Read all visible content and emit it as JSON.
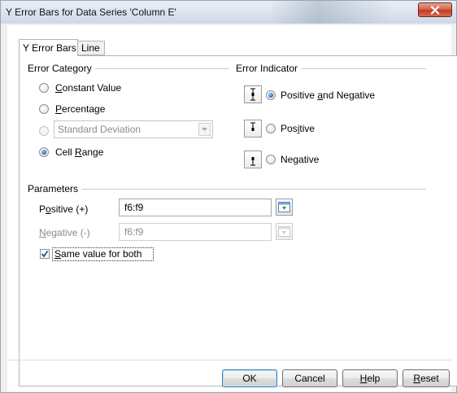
{
  "window": {
    "title": "Y Error Bars for Data Series 'Column E'",
    "close_icon": "close-icon"
  },
  "tabs": [
    {
      "label": "Y Error Bars",
      "active": true
    },
    {
      "label": "Line",
      "active": false
    }
  ],
  "error_category": {
    "label": "Error Category",
    "options": [
      {
        "pre": "",
        "key": "C",
        "post": "onstant Value",
        "checked": false,
        "enabled": true
      },
      {
        "pre": "",
        "key": "P",
        "post": "ercentage",
        "checked": false,
        "enabled": true
      },
      {
        "label": "Standard Deviation",
        "checked": false,
        "enabled": false
      },
      {
        "pre": "Cell ",
        "key": "R",
        "post": "ange",
        "checked": true,
        "enabled": true
      }
    ],
    "dropdown_arrow_icon": "chevron-down-icon"
  },
  "error_indicator": {
    "label": "Error Indicator",
    "options": [
      {
        "pre": "Positive ",
        "key": "a",
        "post": "nd Negative",
        "checked": true,
        "icon": "positive-and-negative-icon"
      },
      {
        "pre": "Pos",
        "key": "i",
        "post": "tive",
        "checked": false,
        "icon": "positive-icon"
      },
      {
        "pre": "Ne",
        "key": "g",
        "post": "ative",
        "checked": false,
        "icon": "negative-icon"
      }
    ]
  },
  "parameters": {
    "label": "Parameters",
    "positive": {
      "pre": "P",
      "key": "o",
      "post": "sitive (+)",
      "value": "f6:f9",
      "enabled": true
    },
    "negative": {
      "pre": "",
      "key": "N",
      "post": "egative (-)",
      "value": "f6:f9",
      "enabled": false
    },
    "same_value": {
      "pre": "",
      "key": "S",
      "post": "ame value for both",
      "checked": true
    },
    "range_icon": "cell-range-select-icon"
  },
  "buttons": {
    "ok": "OK",
    "cancel": "Cancel",
    "help": {
      "pre": "",
      "key": "H",
      "post": "elp"
    },
    "reset": {
      "pre": "",
      "key": "R",
      "post": "eset"
    }
  },
  "colors": {
    "accent_blue": "#2b6fc2",
    "close_red": "#c23c24"
  }
}
